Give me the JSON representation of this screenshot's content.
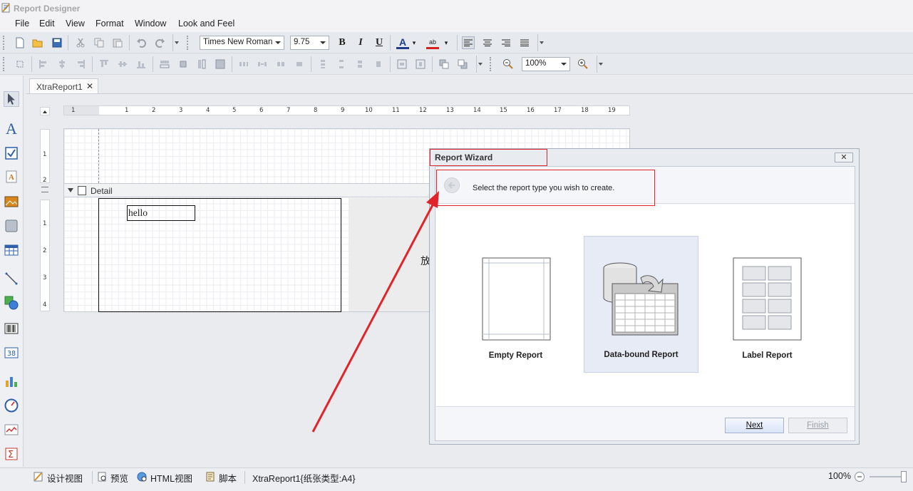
{
  "window": {
    "title": "Report Designer",
    "icon": "report-designer-icon"
  },
  "menu": {
    "items": [
      "File",
      "Edit",
      "View",
      "Format",
      "Window",
      "Look and Feel"
    ]
  },
  "toolbar": {
    "font_family": "Times New Roman",
    "font_size": "9.75",
    "zoom": "100%",
    "bold_label": "B",
    "italic_label": "I",
    "underline_label": "U",
    "fore_color_label": "A",
    "back_color_label": "ab"
  },
  "document": {
    "tab_title": "XtraReport1",
    "ruler_ticks": [
      "1",
      "1",
      "2",
      "3",
      "4",
      "5",
      "6",
      "7",
      "8",
      "9",
      "10",
      "11",
      "12",
      "13",
      "14",
      "15",
      "16",
      "17",
      "18",
      "19"
    ],
    "vruler_top_ticks": [
      "1",
      "2"
    ],
    "vruler_detail_ticks": [
      "1",
      "2",
      "3",
      "4"
    ],
    "band_label": "Detail",
    "label_text": "hello",
    "cjk_char": "放"
  },
  "wizard": {
    "title": "Report Wizard",
    "close_label": "✕",
    "instruction": "Select the report type you wish to create.",
    "options": [
      {
        "label": "Empty Report",
        "selected": false
      },
      {
        "label": "Data-bound Report",
        "selected": true
      },
      {
        "label": "Label Report",
        "selected": false
      }
    ],
    "next_label": "Next",
    "finish_label": "Finish"
  },
  "statusbar": {
    "design_view": "设计视图",
    "preview": "预览",
    "html_view": "HTML视图",
    "script": "脚本",
    "report_info": "XtraReport1{纸张类型:A4}",
    "zoom": "100%"
  },
  "colors": {
    "annotation_red": "#e0242a",
    "selected_option_bg": "#e6ebf6",
    "toolbar_bg": "#e6e9ee"
  }
}
